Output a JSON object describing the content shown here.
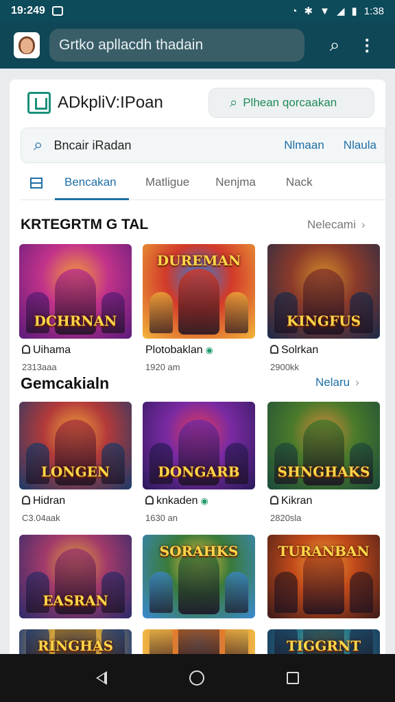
{
  "status_bar": {
    "time": "19:249",
    "right_time": "1:38"
  },
  "browser": {
    "url_text": "Grtko apllacdh thadain"
  },
  "store": {
    "name": "ADkpliV:IPoan",
    "head_search_label": "Plhean qorcaakan"
  },
  "search": {
    "placeholder": "Bncair iRadan",
    "link1": "Nlmaan",
    "link2": "Nlaula"
  },
  "tabs": [
    {
      "label": "Bencakan",
      "active": true
    },
    {
      "label": "Matligue",
      "active": false
    },
    {
      "label": "Nenjma",
      "active": false
    },
    {
      "label": "Nack",
      "active": false
    }
  ],
  "section1": {
    "title": "KRTEGRTM G TAL",
    "link": "Nelecami",
    "items": [
      {
        "art_label": "DCHRNAN",
        "name": "Uihama",
        "sub": "2313aaa",
        "has_user": true,
        "has_eye": false,
        "colors": [
          "#5a1a7a",
          "#c2338a",
          "#f29a3a"
        ]
      },
      {
        "art_label": "DUREMAN",
        "name": "Plotobaklan",
        "sub": "1920 am",
        "has_user": false,
        "has_eye": true,
        "colors": [
          "#f2b63a",
          "#d23a2a",
          "#3a7ad2"
        ]
      },
      {
        "art_label": "KINGFUS",
        "name": "Solrkan",
        "sub": "2900kk",
        "has_user": true,
        "has_eye": false,
        "colors": [
          "#1a2a4a",
          "#8a3a2a",
          "#d2892a"
        ]
      }
    ]
  },
  "section2": {
    "title": "Gemcakialn",
    "link": "Nelaru",
    "items": [
      {
        "art_label": "LONGEN",
        "name": "Hidran",
        "sub": "C3.04aak",
        "has_user": true,
        "has_eye": false,
        "colors": [
          "#1a3a6a",
          "#b23a3a",
          "#f2a23a"
        ]
      },
      {
        "art_label": "DONGARB",
        "name": "knkaden",
        "sub": "1630 an",
        "has_user": true,
        "has_eye": true,
        "colors": [
          "#2a1a5a",
          "#7a2aa2",
          "#e23a5a"
        ]
      },
      {
        "art_label": "SHNGHAKS",
        "name": "Kikran",
        "sub": "2820sla",
        "has_user": true,
        "has_eye": false,
        "colors": [
          "#1a4a3a",
          "#4a7a2a",
          "#d28a3a"
        ]
      }
    ]
  },
  "section3": {
    "items": [
      {
        "art_label": "EASRAN",
        "colors": [
          "#2a2a6a",
          "#a23a6a",
          "#e2a23a"
        ]
      },
      {
        "art_label": "SORAHKS",
        "colors": [
          "#3a8ad2",
          "#3a7a3a",
          "#f2c23a"
        ]
      },
      {
        "art_label": "TURANBAN",
        "colors": [
          "#3a1a1a",
          "#c24a1a",
          "#f2a23a"
        ]
      }
    ]
  },
  "section4": {
    "items": [
      {
        "art_label": "RINGHAS",
        "colors": [
          "#1a3a7a",
          "#d2a23a",
          "#3a5ab2"
        ]
      },
      {
        "art_label": "",
        "colors": [
          "#f2c24a",
          "#e27a2a",
          "#6a9ad2"
        ]
      },
      {
        "art_label": "TIGGRNT",
        "colors": [
          "#1a3a5a",
          "#2a7a8a",
          "#d2b23a"
        ]
      }
    ]
  }
}
